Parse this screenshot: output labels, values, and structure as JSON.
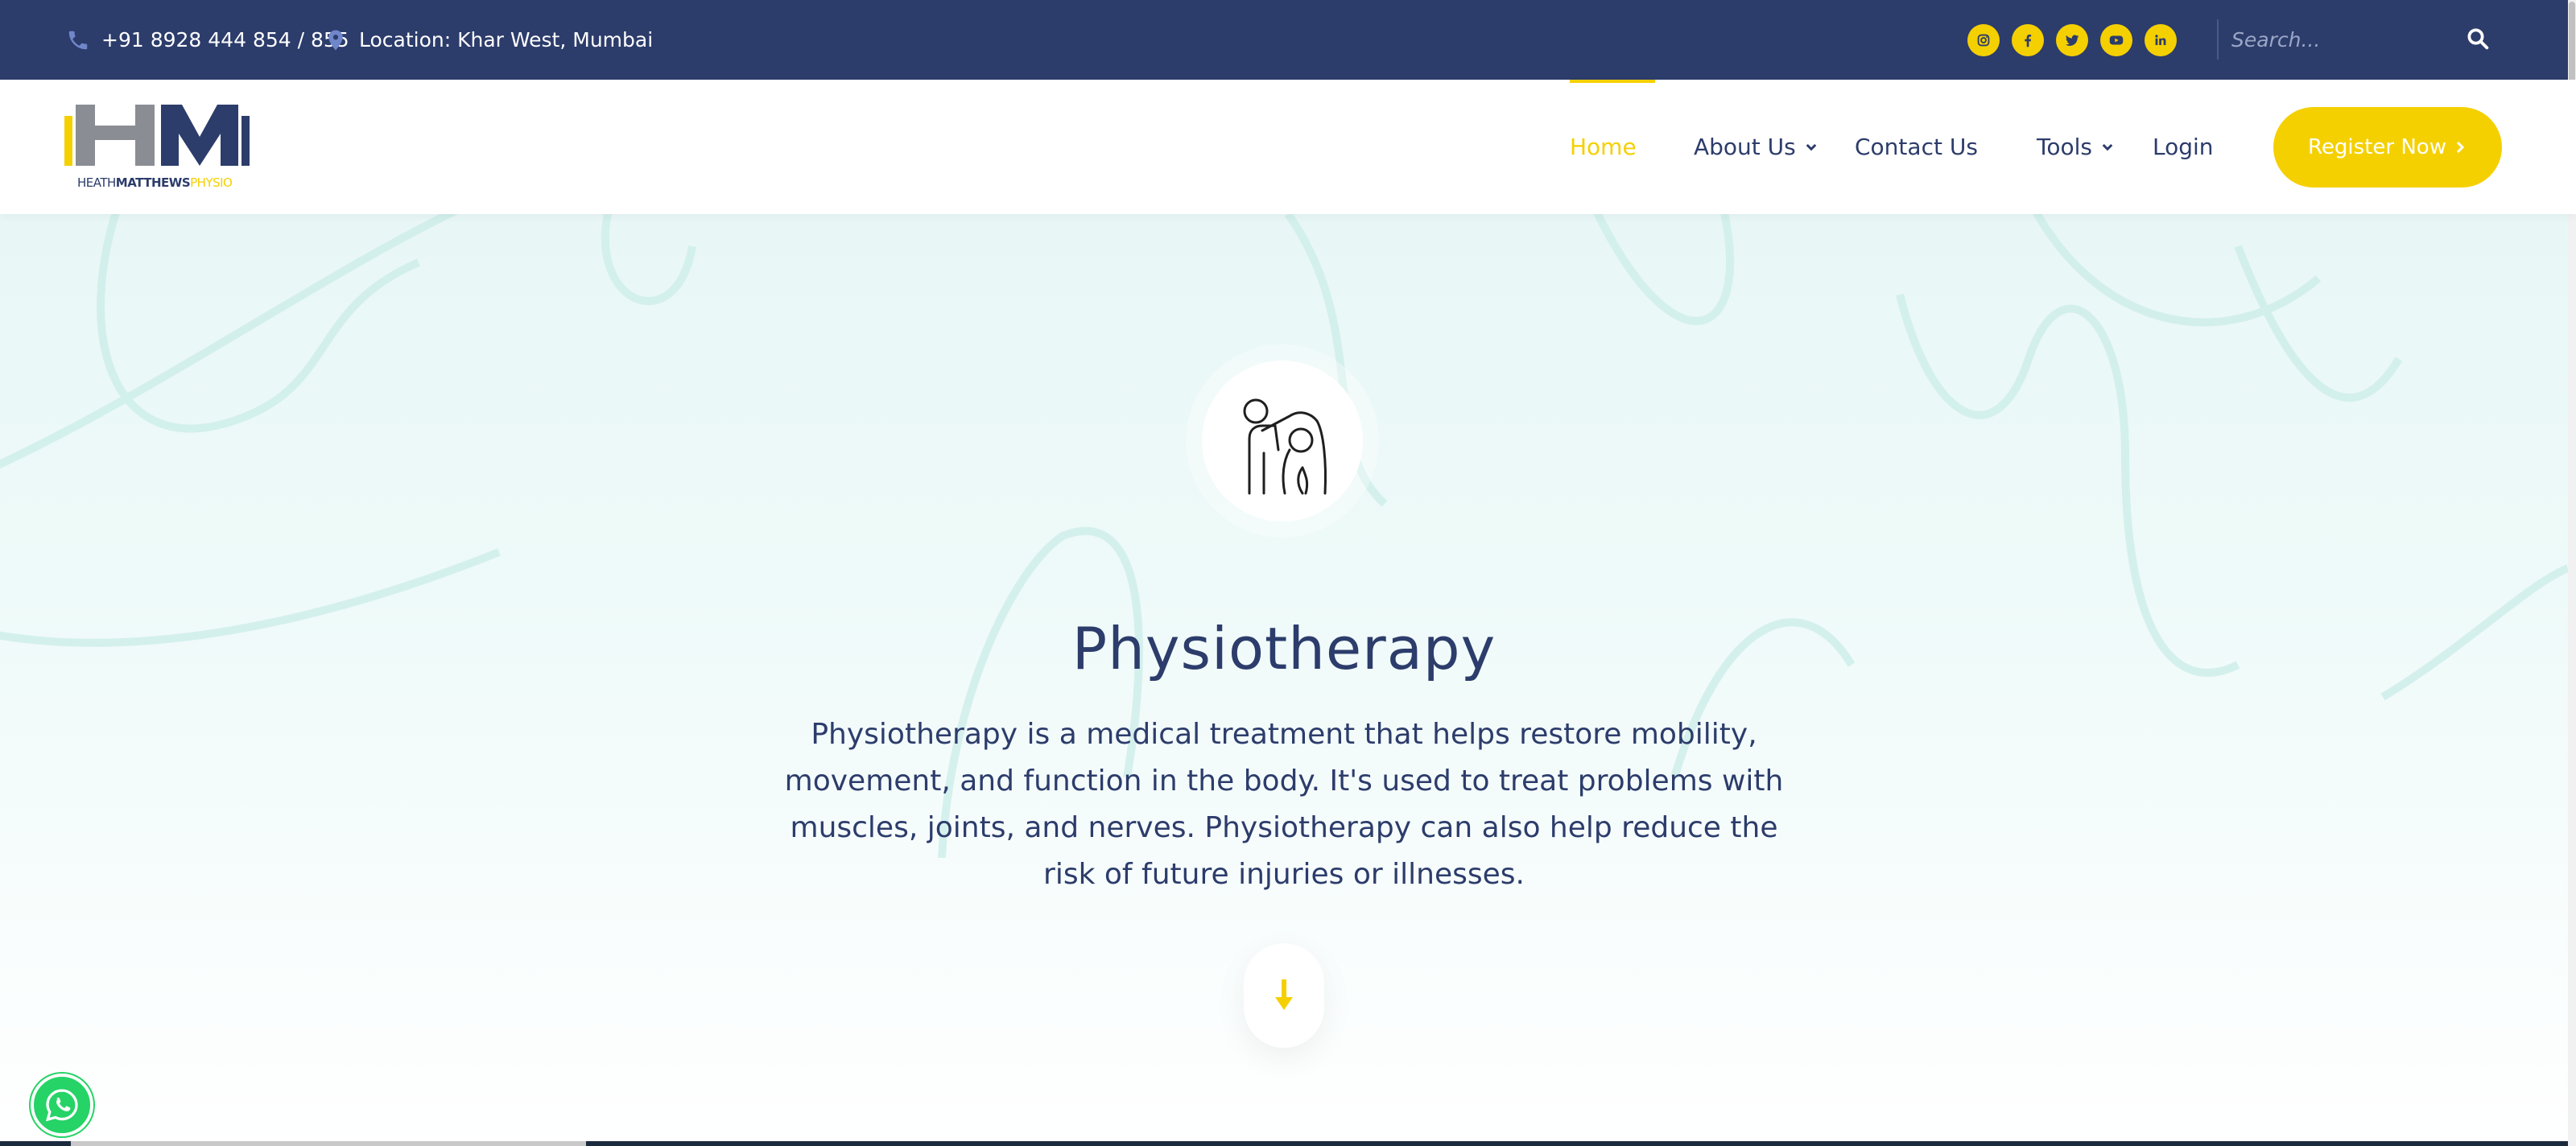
{
  "topbar": {
    "phone": "+91 8928 444 854 / 855",
    "location": "Location: Khar West, Mumbai",
    "socials": [
      {
        "name": "instagram-icon"
      },
      {
        "name": "facebook-icon"
      },
      {
        "name": "twitter-icon"
      },
      {
        "name": "youtube-icon"
      },
      {
        "name": "linkedin-icon"
      }
    ],
    "search_placeholder": "Search..."
  },
  "logo": {
    "text_a": "HEATH",
    "text_b": "MATTHEWS",
    "text_c": "PHYSIO"
  },
  "nav": {
    "home": "Home",
    "about": "About Us",
    "contact": "Contact Us",
    "tools": "Tools",
    "login": "Login",
    "register": "Register Now"
  },
  "hero": {
    "title": "Physiotherapy",
    "description": "Physiotherapy is a medical treatment that helps restore mobility, movement, and function in the body. It's used to treat problems with muscles, joints, and nerves. Physiotherapy can also help reduce the risk of future injuries or illnesses."
  },
  "colors": {
    "navy": "#2c3c6b",
    "accent": "#f5d000",
    "hero_bg": "#e8f7f6",
    "whatsapp": "#25d366"
  }
}
